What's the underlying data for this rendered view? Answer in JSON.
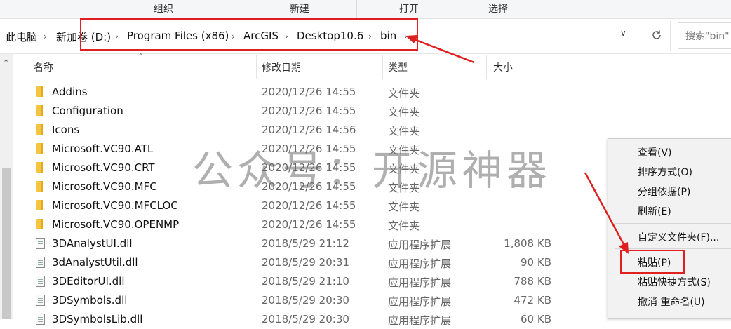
{
  "ribbon": {
    "groups": [
      "组织",
      "新建",
      "打开",
      "选择"
    ]
  },
  "address": {
    "crumbs": [
      "此电脑",
      "新加卷 (D:)",
      "Program Files (x86)",
      "ArcGIS",
      "Desktop10.6",
      "bin"
    ],
    "search_placeholder": "搜索\"bin\""
  },
  "columns": {
    "name": "名称",
    "date": "修改日期",
    "type": "类型",
    "size": "大小"
  },
  "rows": [
    {
      "name": "Addins",
      "date": "2020/12/26 14:55",
      "type": "文件夹",
      "size": "",
      "kind": "folder"
    },
    {
      "name": "Configuration",
      "date": "2020/12/26 14:55",
      "type": "文件夹",
      "size": "",
      "kind": "folder"
    },
    {
      "name": "Icons",
      "date": "2020/12/26 14:56",
      "type": "文件夹",
      "size": "",
      "kind": "folder"
    },
    {
      "name": "Microsoft.VC90.ATL",
      "date": "2020/12/26 14:55",
      "type": "文件夹",
      "size": "",
      "kind": "folder"
    },
    {
      "name": "Microsoft.VC90.CRT",
      "date": "2020/12/26 14:55",
      "type": "文件夹",
      "size": "",
      "kind": "folder"
    },
    {
      "name": "Microsoft.VC90.MFC",
      "date": "2020/12/26 14:55",
      "type": "文件夹",
      "size": "",
      "kind": "folder"
    },
    {
      "name": "Microsoft.VC90.MFCLOC",
      "date": "2020/12/26 14:55",
      "type": "文件夹",
      "size": "",
      "kind": "folder"
    },
    {
      "name": "Microsoft.VC90.OPENMP",
      "date": "2020/12/26 14:55",
      "type": "文件夹",
      "size": "",
      "kind": "folder"
    },
    {
      "name": "3DAnalystUI.dll",
      "date": "2018/5/29 21:12",
      "type": "应用程序扩展",
      "size": "1,808 KB",
      "kind": "file"
    },
    {
      "name": "3dAnalystUtil.dll",
      "date": "2018/5/29 20:31",
      "type": "应用程序扩展",
      "size": "90 KB",
      "kind": "file"
    },
    {
      "name": "3DEditorUI.dll",
      "date": "2018/5/29 21:10",
      "type": "应用程序扩展",
      "size": "788 KB",
      "kind": "file"
    },
    {
      "name": "3DSymbols.dll",
      "date": "2018/5/29 20:30",
      "type": "应用程序扩展",
      "size": "472 KB",
      "kind": "file"
    },
    {
      "name": "3DSymbolsLib.dll",
      "date": "2018/5/29 20:30",
      "type": "应用程序扩展",
      "size": "60 KB",
      "kind": "file"
    }
  ],
  "watermark": "公众号：开源神器",
  "context_menu": {
    "items": [
      "查看(V)",
      "排序方式(O)",
      "分组依据(P)",
      "刷新(E)",
      "自定义文件夹(F)...",
      "粘贴(P)",
      "粘贴快捷方式(S)",
      "撤消 重命名(U)"
    ]
  },
  "colors": {
    "highlight": "#e02020",
    "folder": "#f5c542"
  }
}
